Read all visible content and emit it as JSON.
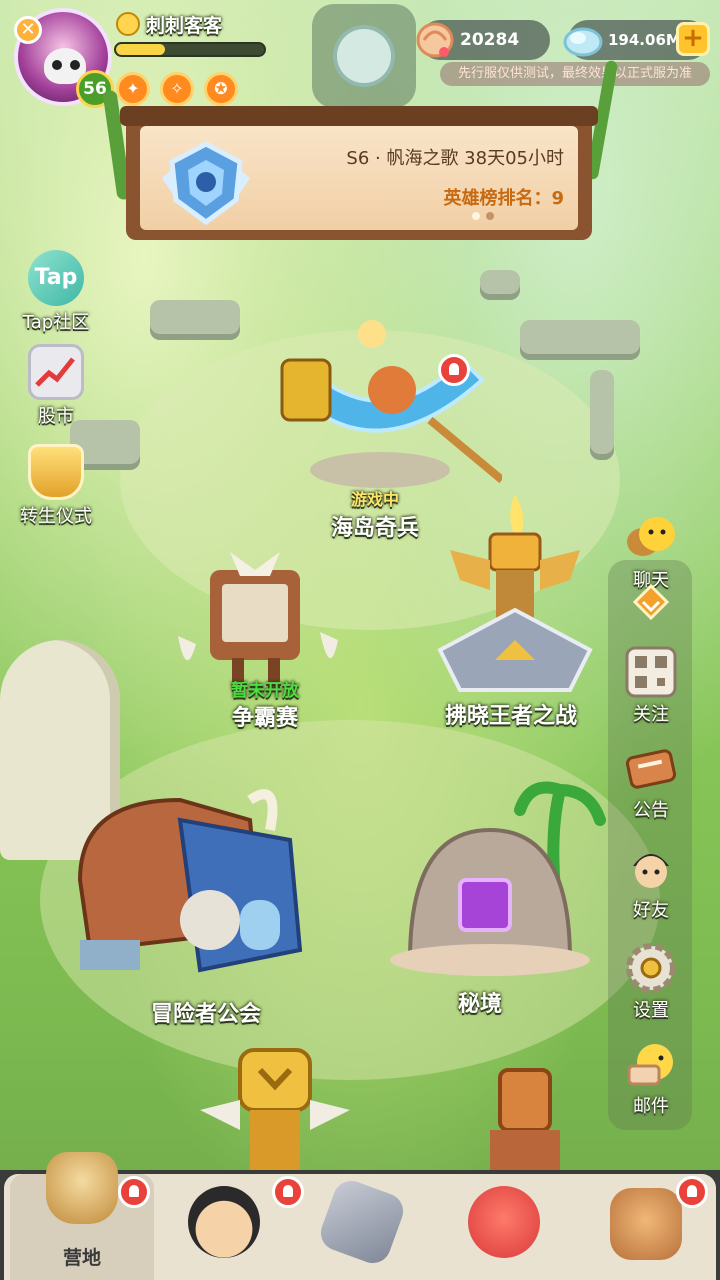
{
  "player": {
    "name": "刺刺客客",
    "level": "56",
    "exp_fraction": 0.33,
    "avatar_icon": "skull-hero-avatar",
    "buffs": [
      "buff-icon-1",
      "buff-icon-2",
      "buff-icon-3"
    ]
  },
  "currencies": {
    "shells": "20284",
    "gems": "194.06M",
    "plus_label": "+"
  },
  "notice": "先行服仅供测试，最终效果以正式服为准",
  "season": {
    "title": "S6 · 帆海之歌 38天05小时",
    "rank": "英雄榜排名：9",
    "page_count": 2,
    "active_page": 1
  },
  "left_menu": [
    {
      "label": "Tap社区",
      "icon": "tap-icon"
    },
    {
      "label": "股市",
      "icon": "stock-chart-icon"
    },
    {
      "label": "转生仪式",
      "icon": "reincarnation-trophy-icon"
    }
  ],
  "buildings": {
    "island": {
      "label": "海岛奇兵",
      "status": "游戏中"
    },
    "contest": {
      "label": "争霸赛",
      "status": "暂未开放"
    },
    "dawn_king": {
      "label": "拂晓王者之战"
    },
    "guild": {
      "label": "冒险者公会"
    },
    "secret": {
      "label": "秘境"
    }
  },
  "right_menu": [
    {
      "label": "聊天",
      "icon": "chat-icon"
    },
    {
      "label": "",
      "icon": "collapse-chevron-icon"
    },
    {
      "label": "关注",
      "icon": "qr-code-icon"
    },
    {
      "label": "公告",
      "icon": "announcement-scroll-icon"
    },
    {
      "label": "好友",
      "icon": "friends-icon"
    },
    {
      "label": "设置",
      "icon": "gear-icon"
    },
    {
      "label": "邮件",
      "icon": "mail-bird-icon"
    }
  ],
  "bottom_nav": [
    {
      "label": "营地",
      "icon": "camp-icon",
      "active": true,
      "alert": true
    },
    {
      "label": "",
      "icon": "hero-icon",
      "active": false,
      "alert": true
    },
    {
      "label": "",
      "icon": "battle-sword-icon",
      "active": false,
      "alert": false
    },
    {
      "label": "",
      "icon": "pet-dragon-icon",
      "active": false,
      "alert": false
    },
    {
      "label": "",
      "icon": "shop-tribe-icon",
      "active": false,
      "alert": true
    }
  ],
  "colors": {
    "accent_gold": "#ffc42c",
    "alert_red": "#e8423a",
    "status_green": "#4fdc40",
    "wood": "#8a5430"
  }
}
